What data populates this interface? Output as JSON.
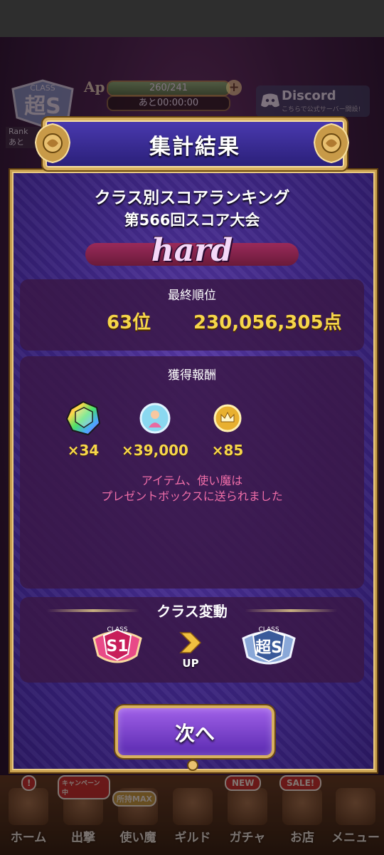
{
  "hud": {
    "class_badge_text": "超S",
    "class_caption": "CLASS",
    "ap_label": "Ap",
    "ap_value": "260/241",
    "ap_timer_prefix": "あと",
    "ap_timer": "00:00:00",
    "discord_label": "Discord",
    "discord_sub": "こちらで公式サーバー開設!",
    "rank_label": "Rank",
    "rank_sub": "あと"
  },
  "dialog": {
    "title": "集計結果",
    "ranking_heading": "クラス別スコアランキング",
    "contest_name": "第566回スコア大会",
    "difficulty": "hard",
    "final_rank_label": "最終順位",
    "rank": "63位",
    "score": "230,056,305点",
    "reward_label": "獲得報酬",
    "rewards": [
      {
        "icon": "rainbow-gem-icon",
        "qty": "×34"
      },
      {
        "icon": "familiar-card-icon",
        "qty": "×39,000"
      },
      {
        "icon": "gold-crown-coin-icon",
        "qty": "×85"
      }
    ],
    "note_line1": "アイテム、使い魔は",
    "note_line2": "プレゼントボックスに送られました",
    "class_change_label": "クラス変動",
    "from_class": "S1",
    "to_class": "超S",
    "class_caption": "CLASS",
    "up_label": "UP",
    "next_button": "次へ"
  },
  "nav": {
    "items": [
      {
        "label": "ホーム",
        "badge": "!"
      },
      {
        "label": "出撃",
        "badge": "キャンペーン中"
      },
      {
        "label": "使い魔",
        "badge": "所持MAX"
      },
      {
        "label": "ギルド",
        "badge": ""
      },
      {
        "label": "ガチャ",
        "badge": "NEW"
      },
      {
        "label": "お店",
        "badge": "SALE!"
      },
      {
        "label": "メニュー",
        "badge": ""
      }
    ]
  },
  "colors": {
    "gold_text": "#f6d64a",
    "note_pink": "#f06ea8",
    "dialog_purple": "#3c2580",
    "frame_gold": "#c8a050"
  }
}
